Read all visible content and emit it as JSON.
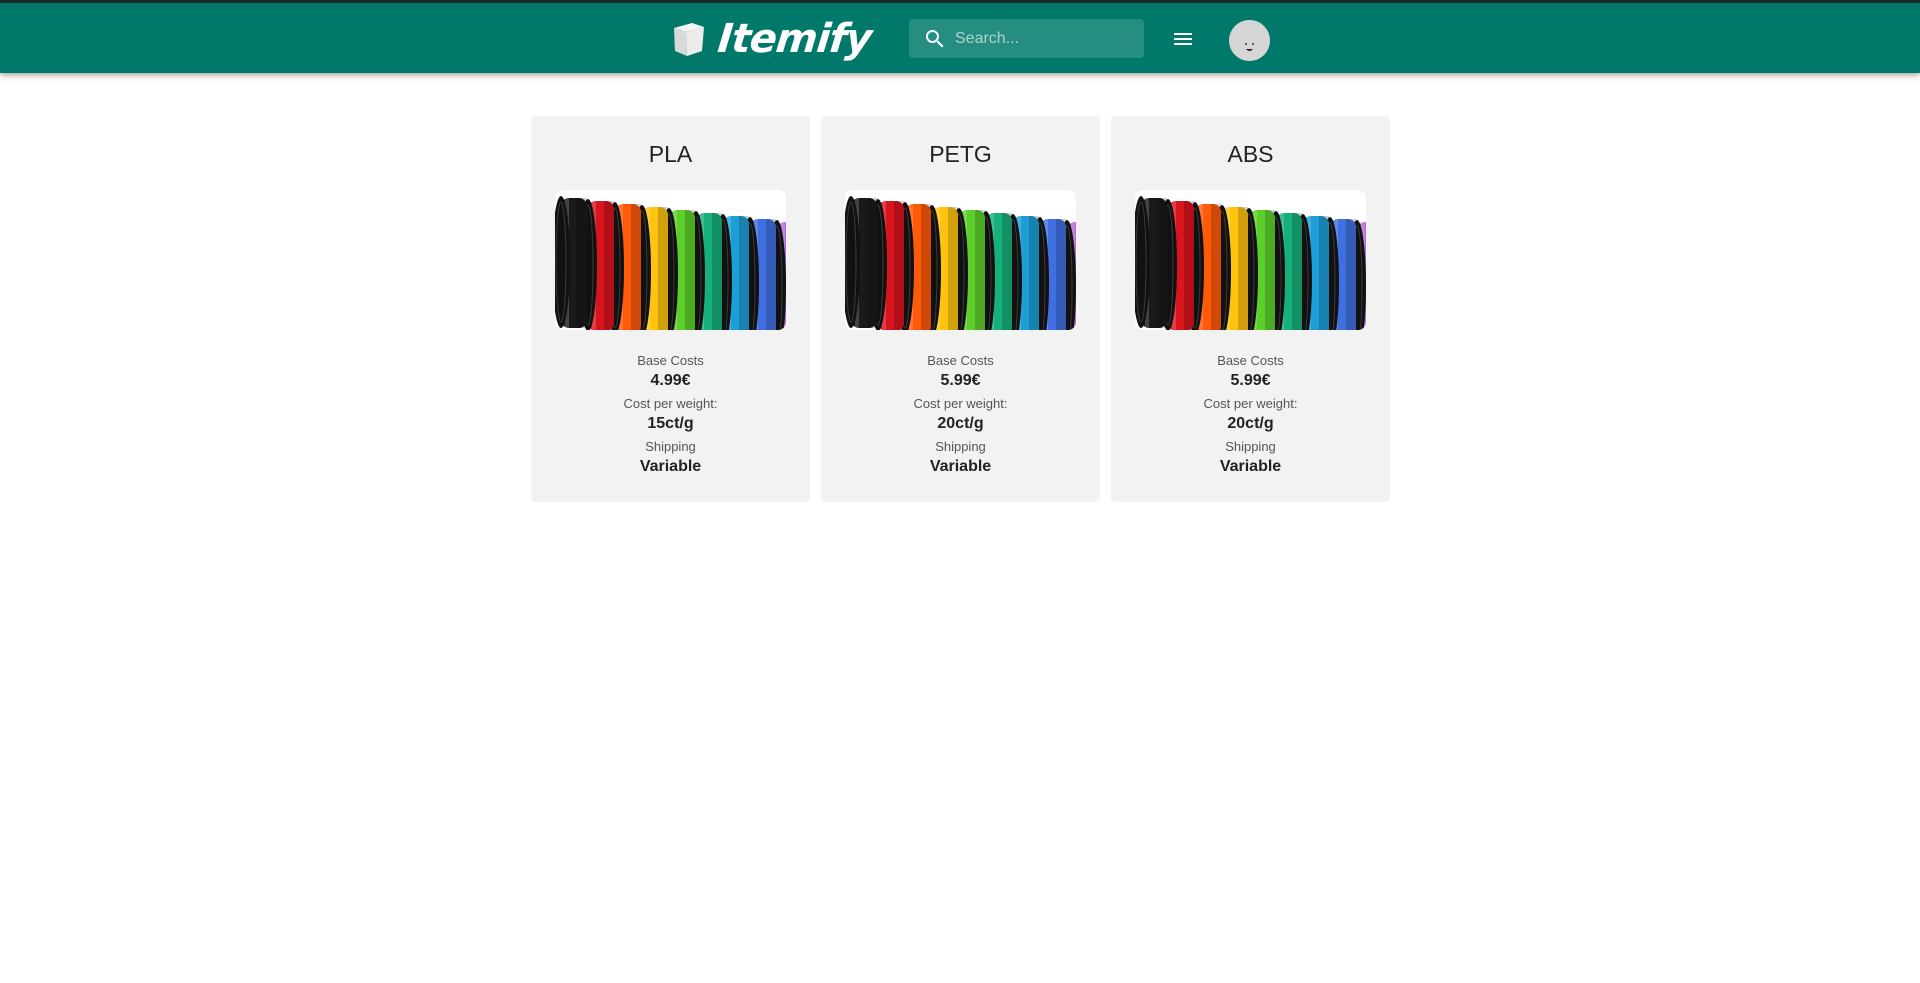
{
  "header": {
    "logo_text": "Itemify",
    "search_placeholder": "Search...",
    "accent_color": "#00796b"
  },
  "icons": {
    "logo": "cube-icon",
    "search": "search-icon",
    "menu": "menu-icon",
    "avatar": "user-avatar"
  },
  "materials": [
    {
      "name": "PLA",
      "base_costs_label": "Base Costs",
      "base_costs": "4.99€",
      "cost_per_weight_label": "Cost per weight:",
      "cost_per_weight": "15ct/g",
      "shipping_label": "Shipping",
      "shipping": "Variable"
    },
    {
      "name": "PETG",
      "base_costs_label": "Base Costs",
      "base_costs": "5.99€",
      "cost_per_weight_label": "Cost per weight:",
      "cost_per_weight": "20ct/g",
      "shipping_label": "Shipping",
      "shipping": "Variable"
    },
    {
      "name": "ABS",
      "base_costs_label": "Base Costs",
      "base_costs": "5.99€",
      "cost_per_weight_label": "Cost per weight:",
      "cost_per_weight": "20ct/g",
      "shipping_label": "Shipping",
      "shipping": "Variable"
    }
  ]
}
